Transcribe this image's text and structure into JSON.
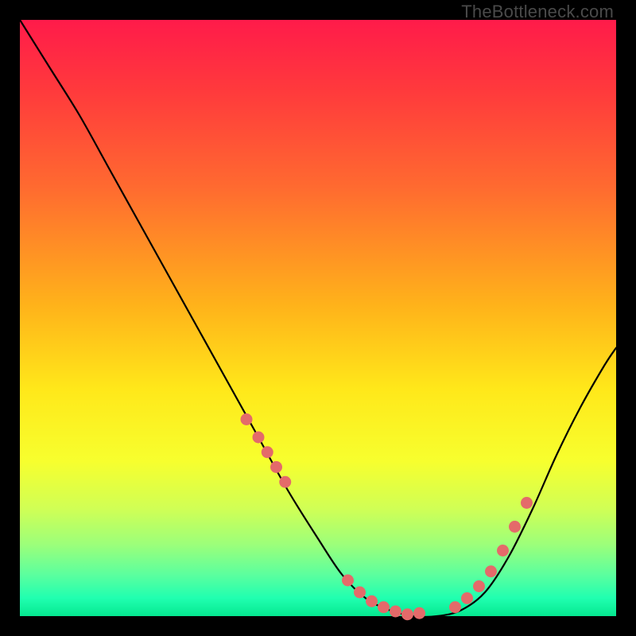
{
  "watermark": "TheBottleneck.com",
  "colors": {
    "curve_stroke": "#000000",
    "marker_fill": "#e46a6a",
    "background_border": "#000000"
  },
  "chart_data": {
    "type": "line",
    "title": "",
    "xlabel": "",
    "ylabel": "",
    "xlim": [
      0,
      100
    ],
    "ylim": [
      0,
      100
    ],
    "x": [
      0,
      5,
      10,
      15,
      20,
      25,
      30,
      35,
      40,
      45,
      50,
      54,
      58,
      62,
      66,
      70,
      74,
      78,
      82,
      86,
      90,
      94,
      98,
      100
    ],
    "y": [
      100,
      92,
      84,
      75,
      66,
      57,
      48,
      39,
      30,
      21,
      13,
      7,
      3,
      1,
      0,
      0,
      1,
      4,
      10,
      18,
      27,
      35,
      42,
      45
    ],
    "markers": {
      "x": [
        38,
        40,
        41.5,
        43,
        44.5,
        55,
        57,
        59,
        61,
        63,
        65,
        67,
        75,
        77,
        79,
        81,
        83,
        85,
        73
      ],
      "y": [
        33,
        30,
        27.5,
        25,
        22.5,
        6,
        4,
        2.5,
        1.5,
        0.8,
        0.3,
        0.5,
        3,
        5,
        7.5,
        11,
        15,
        19,
        1.5
      ]
    }
  }
}
